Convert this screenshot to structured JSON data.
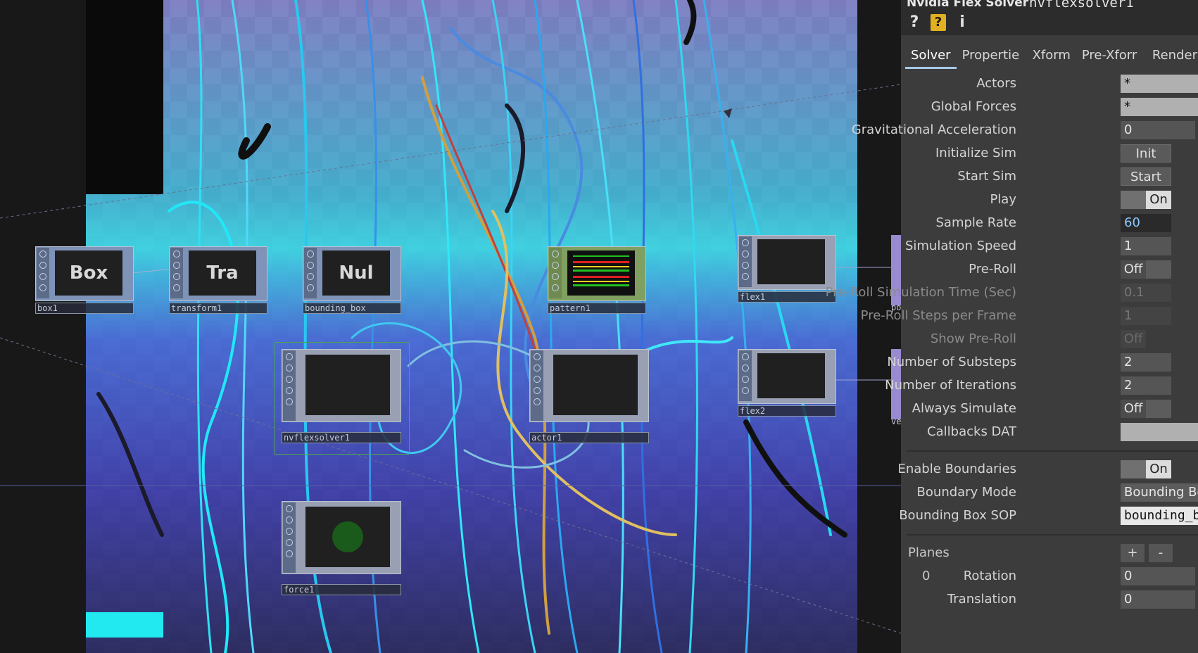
{
  "panel": {
    "title": "Nvidia Flex Solver",
    "name": "nvflexsolver1",
    "icons": [
      "help-icon",
      "python-help-icon",
      "info-icon"
    ],
    "icon_glyphs": {
      "help": "?",
      "python_help": "?",
      "info": "i"
    },
    "tabs": [
      {
        "label": "Solver",
        "active": true
      },
      {
        "label": "Propertie",
        "active": false
      },
      {
        "label": "Xform",
        "active": false
      },
      {
        "label": "Pre-Xforr",
        "active": false
      },
      {
        "label": "Render",
        "active": false
      }
    ],
    "params": {
      "actors": {
        "label": "Actors",
        "value": "*"
      },
      "global_forces": {
        "label": "Global Forces",
        "value": "*"
      },
      "grav_accel": {
        "label": "Gravitational Acceleration",
        "value": "0"
      },
      "init_sim": {
        "label": "Initialize Sim",
        "button": "Init"
      },
      "start_sim": {
        "label": "Start Sim",
        "button": "Start"
      },
      "play": {
        "label": "Play",
        "value": "On"
      },
      "sample_rate": {
        "label": "Sample Rate",
        "value": "60"
      },
      "sim_speed": {
        "label": "Simulation Speed",
        "value": "1"
      },
      "pre_roll": {
        "label": "Pre-Roll",
        "value": "Off"
      },
      "pre_roll_time": {
        "label": "Pre-Roll Simulation Time (Sec)",
        "value": "0.1"
      },
      "pre_roll_steps": {
        "label": "Pre-Roll Steps per Frame",
        "value": "1"
      },
      "show_pre_roll": {
        "label": "Show Pre-Roll",
        "value": "Off"
      },
      "substeps": {
        "label": "Number of Substeps",
        "value": "2"
      },
      "iterations": {
        "label": "Number of Iterations",
        "value": "2"
      },
      "always_sim": {
        "label": "Always Simulate",
        "value": "Off"
      },
      "callbacks": {
        "label": "Callbacks DAT",
        "value": ""
      },
      "enable_bounds": {
        "label": "Enable Boundaries",
        "value": "On"
      },
      "boundary_mode": {
        "label": "Boundary Mode",
        "value": "Bounding Bo"
      },
      "bbox_sop": {
        "label": "Bounding Box SOP",
        "value": "bounding_b"
      },
      "planes": {
        "label": "Planes",
        "add": "+",
        "remove": "-"
      },
      "plane_index": "0",
      "rotation": {
        "label": "Rotation",
        "value": "0"
      },
      "translation": {
        "label": "Translation",
        "value": "0"
      }
    }
  },
  "network": {
    "nodes": [
      {
        "id": "box1",
        "label": "box1",
        "display": "Box"
      },
      {
        "id": "transform1",
        "label": "transform1",
        "display": "Tra"
      },
      {
        "id": "bounding_box",
        "label": "bounding_box",
        "display": "Nul"
      },
      {
        "id": "pattern1",
        "label": "pattern1",
        "display": ""
      },
      {
        "id": "flex1",
        "label": "flex1",
        "display": ""
      },
      {
        "id": "flex2",
        "label": "flex2",
        "display": ""
      },
      {
        "id": "nvflexsolver1",
        "label": "nvflexsolver1",
        "display": ""
      },
      {
        "id": "actor1",
        "label": "actor1",
        "display": ""
      },
      {
        "id": "force1",
        "label": "force1",
        "display": ""
      },
      {
        "id": "po",
        "label": "po",
        "display": ""
      },
      {
        "id": "ve",
        "label": "ve",
        "display": ""
      }
    ]
  }
}
